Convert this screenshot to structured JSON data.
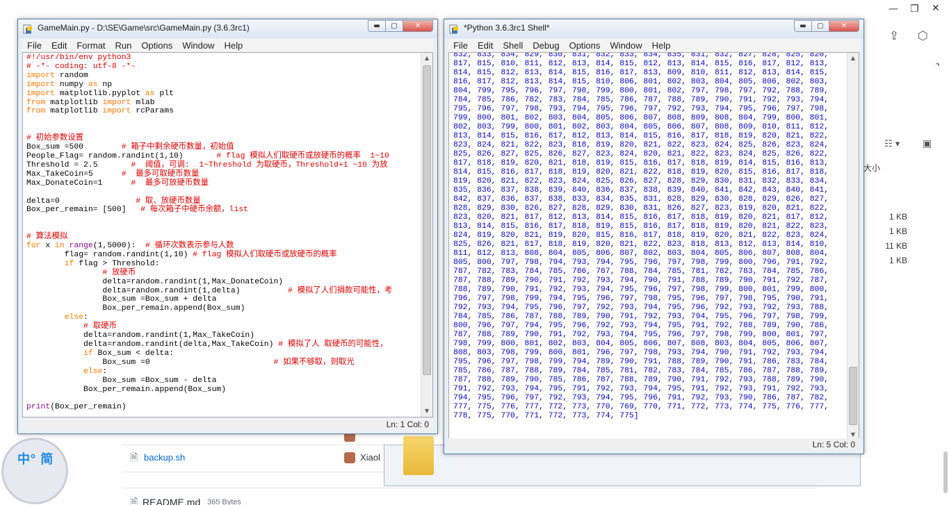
{
  "background": {
    "file_sizes": [
      "1 KB",
      "1 KB",
      "11 KB",
      "1 KB"
    ],
    "column_header": "大小",
    "files": [
      {
        "name": "backup.sh",
        "user": "Xiaol"
      },
      {
        "name": "README.md",
        "size": "365 Bytes"
      }
    ],
    "badge_text": "中° 简"
  },
  "editor": {
    "title": "GameMain.py - D:\\SE\\Game\\src\\GameMain.py (3.6.3rc1)",
    "menu": [
      "File",
      "Edit",
      "Format",
      "Run",
      "Options",
      "Window",
      "Help"
    ],
    "code_lines": [
      [
        {
          "c": "cmt",
          "t": "#!/usr/bin/env python3"
        }
      ],
      [
        {
          "c": "cmt",
          "t": "# -*- coding: utf-8 -*-"
        }
      ],
      [
        {
          "c": "kw",
          "t": "import"
        },
        {
          "t": " random"
        }
      ],
      [
        {
          "c": "kw",
          "t": "import"
        },
        {
          "t": " numpy "
        },
        {
          "c": "kw",
          "t": "as"
        },
        {
          "t": " np"
        }
      ],
      [
        {
          "c": "kw",
          "t": "import"
        },
        {
          "t": " matplotlib.pyplot "
        },
        {
          "c": "kw",
          "t": "as"
        },
        {
          "t": " plt"
        }
      ],
      [
        {
          "c": "kw",
          "t": "from"
        },
        {
          "t": " matplotlib "
        },
        {
          "c": "kw",
          "t": "import"
        },
        {
          "t": " mlab"
        }
      ],
      [
        {
          "c": "kw",
          "t": "from"
        },
        {
          "t": " matplotlib "
        },
        {
          "c": "kw",
          "t": "import"
        },
        {
          "t": " rcParams"
        }
      ],
      [],
      [],
      [
        {
          "c": "cmt",
          "t": "# 初始参数设置"
        }
      ],
      [
        {
          "t": "Box_sum =500        "
        },
        {
          "c": "cmt",
          "t": "# 箱子中剩余硬币数量，初始值"
        }
      ],
      [
        {
          "t": "People_Flag= random.randint(1,10)       "
        },
        {
          "c": "cmt",
          "t": "# flag 模拟人们取硬币或放硬币的概率  1~10"
        }
      ],
      [
        {
          "t": "Threshold = 2.5       "
        },
        {
          "c": "cmt",
          "t": "#  阈值，可调:  1~Threshold 为取硬币，Threshold+1 ~10 为放"
        }
      ],
      [
        {
          "t": "Max_TakeCoin=5      "
        },
        {
          "c": "cmt",
          "t": "#  最多可取硬币数量"
        }
      ],
      [
        {
          "t": "Max_DonateCoin=1      "
        },
        {
          "c": "cmt",
          "t": "#  最多可放硬币数量"
        }
      ],
      [],
      [
        {
          "t": "delta=0                "
        },
        {
          "c": "cmt",
          "t": "# 取、放硬币数量"
        }
      ],
      [
        {
          "t": "Box_per_remain= [500]   "
        },
        {
          "c": "cmt",
          "t": "# 每次箱子中硬币余额，list"
        }
      ],
      [],
      [],
      [
        {
          "c": "cmt",
          "t": "# 算法模拟"
        }
      ],
      [
        {
          "c": "kw",
          "t": "for"
        },
        {
          "t": " x "
        },
        {
          "c": "kw",
          "t": "in"
        },
        {
          "t": " "
        },
        {
          "c": "bi",
          "t": "range"
        },
        {
          "t": "(1,5000):  "
        },
        {
          "c": "cmt",
          "t": "# 循环次数表示参与人数"
        }
      ],
      [
        {
          "t": "        flag= random.randint(1,10) "
        },
        {
          "c": "cmt",
          "t": "# flag 模拟人们取硬币或放硬币的概率"
        }
      ],
      [
        {
          "t": "        "
        },
        {
          "c": "kw",
          "t": "if"
        },
        {
          "t": " flag > Threshold:"
        }
      ],
      [
        {
          "t": "                "
        },
        {
          "c": "cmt",
          "t": "# 放硬币"
        }
      ],
      [
        {
          "t": "                delta=random.randint(1,Max_DonateCoin)"
        }
      ],
      [
        {
          "t": "                delta=random.randint(1,delta)          "
        },
        {
          "c": "cmt",
          "t": "# 模拟了人们捐款可能性，考"
        }
      ],
      [
        {
          "t": "                Box_sum =Box_sum + delta"
        }
      ],
      [
        {
          "t": "                Box_per_remain.append(Box_sum)"
        }
      ],
      [
        {
          "t": "        "
        },
        {
          "c": "kw",
          "t": "else"
        },
        {
          "t": ":"
        }
      ],
      [
        {
          "t": "            "
        },
        {
          "c": "cmt",
          "t": "# 取硬币"
        }
      ],
      [
        {
          "t": "            delta=random.randint(1,Max_TakeCoin)"
        }
      ],
      [
        {
          "t": "            delta=random.randint(delta,Max_TakeCoin) "
        },
        {
          "c": "cmt",
          "t": "# 模拟了人 取硬币的可能性，"
        }
      ],
      [
        {
          "t": "            "
        },
        {
          "c": "kw",
          "t": "if"
        },
        {
          "t": " Box_sum < delta:"
        }
      ],
      [
        {
          "t": "                Box_sum =0                          "
        },
        {
          "c": "cmt",
          "t": "# 如果不够取，则取光"
        }
      ],
      [
        {
          "t": "            "
        },
        {
          "c": "kw",
          "t": "else"
        },
        {
          "t": ":"
        }
      ],
      [
        {
          "t": "                Box_sum =Box_sum - delta"
        }
      ],
      [
        {
          "t": "            Box_per_remain.append(Box_sum)"
        }
      ],
      [],
      [
        {
          "c": "bi",
          "t": "print"
        },
        {
          "t": "(Box_per_remain)"
        }
      ]
    ],
    "status": "Ln: 1   Col: 0"
  },
  "shell": {
    "title": "*Python 3.6.3rc1 Shell*",
    "menu": [
      "File",
      "Edit",
      "Shell",
      "Debug",
      "Options",
      "Window",
      "Help"
    ],
    "output_lines": [
      "832, 833, 834, 829, 830, 831, 832, 833, 834, 835, 831, 832, 827, 828, 825, 820,",
      "817, 815, 810, 811, 812, 813, 814, 815, 812, 813, 814, 815, 816, 817, 812, 813,",
      "814, 815, 812, 813, 814, 815, 816, 817, 813, 809, 810, 811, 812, 813, 814, 815,",
      "816, 817, 812, 813, 814, 815, 810, 806, 801, 802, 803, 804, 805, 806, 802, 803,",
      "804, 799, 795, 796, 797, 798, 799, 800, 801, 802, 797, 798, 797, 792, 788, 789,",
      "784, 785, 786, 782, 783, 784, 785, 786, 787, 788, 789, 790, 791, 792, 793, 794,",
      "795, 796, 797, 798, 793, 794, 795, 796, 797, 792, 793, 794, 795, 796, 797, 798,",
      "799, 800, 801, 802, 803, 804, 805, 806, 807, 808, 809, 808, 804, 799, 800, 801,",
      "802, 803, 799, 800, 801, 802, 803, 804, 805, 806, 807, 808, 809, 810, 811, 812,",
      "813, 814, 815, 816, 817, 812, 813, 814, 815, 816, 817, 818, 819, 820, 821, 822,",
      "823, 824, 821, 822, 823, 818, 819, 820, 821, 822, 823, 824, 825, 826, 823, 824,",
      "825, 826, 827, 825, 826, 827, 823, 824, 820, 821, 822, 823, 824, 825, 826, 822,",
      "817, 818, 819, 820, 821, 818, 819, 815, 816, 817, 818, 819, 814, 815, 816, 813,",
      "814, 815, 816, 817, 818, 819, 820, 821, 822, 818, 819, 820, 815, 816, 817, 818,",
      "819, 820, 821, 822, 823, 824, 825, 826, 827, 828, 829, 830, 831, 832, 833, 834,",
      "835, 836, 837, 838, 839, 840, 836, 837, 838, 839, 840, 841, 842, 843, 840, 841,",
      "842, 837, 836, 837, 838, 833, 834, 835, 831, 828, 829, 830, 828, 829, 826, 827,",
      "828, 829, 830, 826, 827, 828, 829, 830, 831, 826, 827, 823, 819, 820, 821, 822,",
      "823, 820, 821, 817, 812, 813, 814, 815, 816, 817, 818, 819, 820, 821, 817, 812,",
      "813, 814, 815, 816, 817, 818, 819, 815, 816, 817, 818, 819, 820, 821, 822, 823,",
      "824, 819, 820, 821, 819, 820, 815, 816, 817, 818, 819, 820, 821, 822, 823, 824,",
      "825, 826, 821, 817, 818, 819, 820, 821, 822, 823, 818, 813, 812, 813, 814, 810,",
      "811, 812, 813, 808, 804, 805, 806, 807, 802, 803, 804, 805, 806, 807, 808, 804,",
      "805, 800, 797, 798, 794, 793, 794, 795, 796, 797, 798, 799, 800, 796, 791, 792,",
      "787, 782, 783, 784, 785, 786, 787, 788, 784, 785, 781, 782, 783, 784, 785, 786,",
      "787, 788, 789, 790, 791, 792, 793, 794, 790, 791, 788, 789, 790, 791, 792, 787,",
      "788, 789, 790, 791, 792, 793, 794, 795, 796, 797, 798, 799, 800, 801, 799, 800,",
      "796, 797, 798, 799, 794, 795, 796, 797, 798, 795, 796, 797, 798, 795, 790, 791,",
      "792, 793, 794, 795, 796, 797, 792, 793, 794, 795, 796, 792, 793, 792, 793, 788,",
      "784, 785, 786, 787, 788, 789, 790, 791, 792, 793, 794, 795, 796, 797, 798, 799,",
      "800, 796, 797, 794, 795, 796, 792, 793, 794, 795, 791, 792, 788, 789, 790, 786,",
      "787, 788, 789, 790, 791, 792, 793, 794, 795, 796, 797, 798, 799, 800, 801, 797,",
      "798, 799, 800, 801, 802, 803, 804, 805, 806, 807, 808, 803, 804, 805, 806, 807,",
      "808, 803, 798, 799, 800, 801, 796, 797, 798, 793, 794, 790, 791, 792, 793, 794,",
      "795, 796, 797, 798, 799, 794, 789, 790, 791, 788, 789, 790, 791, 786, 783, 784,",
      "785, 786, 787, 788, 789, 784, 785, 781, 782, 783, 784, 785, 786, 787, 788, 789,",
      "787, 788, 789, 790, 785, 786, 787, 788, 789, 790, 791, 792, 793, 788, 789, 790,",
      "791, 792, 793, 794, 795, 791, 792, 793, 794, 795, 791, 792, 793, 791, 792, 793,",
      "794, 795, 796, 797, 792, 793, 794, 795, 796, 791, 792, 793, 790, 786, 787, 782,",
      "777, 775, 776, 777, 772, 773, 770, 769, 770, 771, 772, 773, 774, 775, 776, 777,",
      "778, 775, 770, 771, 772, 773, 774, 775]"
    ],
    "status": "Ln: 5   Col: 0"
  }
}
